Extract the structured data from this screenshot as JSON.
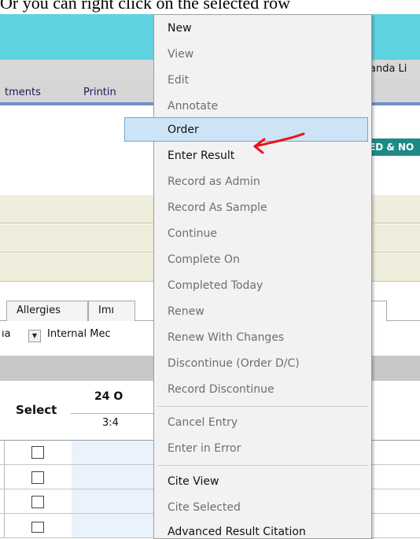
{
  "caption": "Or you can right click on the selected row",
  "app": {
    "user_name_partial": "anda Li",
    "nav_tabs": [
      "tments",
      "Printin"
    ],
    "status_badge": "ED & NO",
    "sub_tabs": [
      "Allergies",
      "Imı"
    ],
    "filter": {
      "left_text": "ıa",
      "dropdown_icon": "triangle-down-icon",
      "main_text": "Internal Mec"
    },
    "grid": {
      "select_header": "Select",
      "date_header": "24 O",
      "time_header": "3:4",
      "rows": [
        {
          "checked": false
        },
        {
          "checked": false
        },
        {
          "checked": false
        },
        {
          "checked": false
        }
      ]
    }
  },
  "context_menu": {
    "items": [
      {
        "label": "New",
        "enabled": true
      },
      {
        "label": "View",
        "enabled": false
      },
      {
        "label": "Edit",
        "enabled": false
      },
      {
        "label": "Annotate",
        "enabled": false
      },
      {
        "label": "Order",
        "enabled": true,
        "highlighted": true
      },
      {
        "label": "Enter Result",
        "enabled": true
      },
      {
        "label": "Record as Admin",
        "enabled": false
      },
      {
        "label": "Record As Sample",
        "enabled": false
      },
      {
        "label": "Continue",
        "enabled": false
      },
      {
        "label": "Complete On",
        "enabled": false
      },
      {
        "label": "Completed Today",
        "enabled": false
      },
      {
        "label": "Renew",
        "enabled": false
      },
      {
        "label": "Renew With Changes",
        "enabled": false
      },
      {
        "label": "Discontinue (Order D/C)",
        "enabled": false
      },
      {
        "label": "Record Discontinue",
        "enabled": false
      },
      {
        "label": "Cancel Entry",
        "enabled": false
      },
      {
        "label": "Enter in Error",
        "enabled": false
      },
      {
        "label": "Cite View",
        "enabled": true
      },
      {
        "label": "Cite Selected",
        "enabled": false
      },
      {
        "label": "Advanced Result Citation",
        "enabled": true
      }
    ]
  },
  "annotation": {
    "type": "red-arrow",
    "color": "#e8141b"
  },
  "colors": {
    "banner": "#5fd2e0",
    "menu_highlight": "#cde4f7",
    "status_badge": "#1e8a86",
    "grid_cell": "#eaf3fb"
  }
}
